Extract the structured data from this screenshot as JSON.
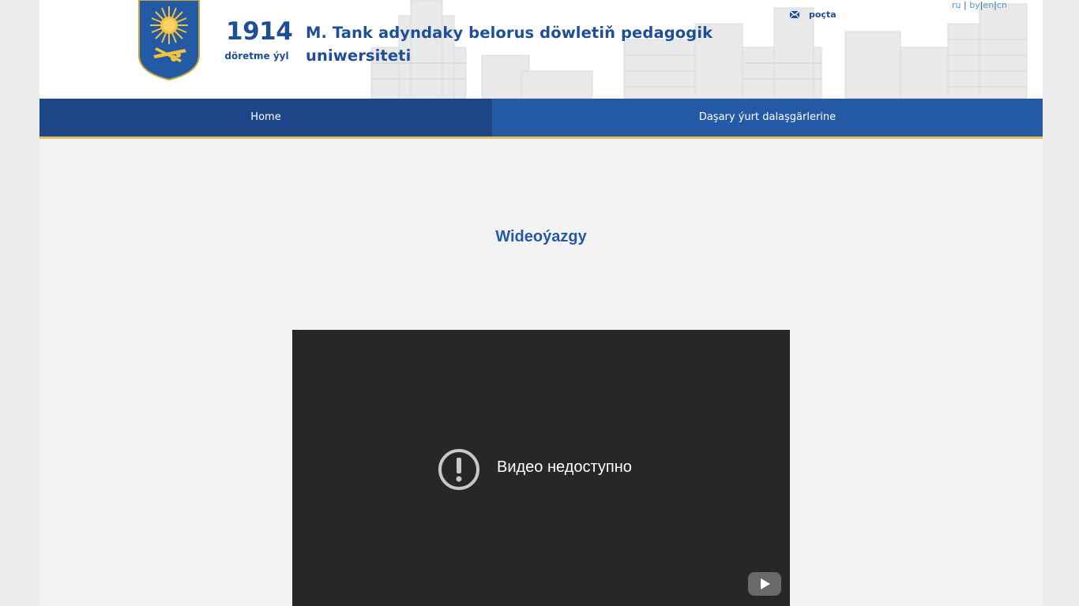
{
  "header": {
    "year": "1914",
    "year_caption": "döretme ýyl",
    "university_name": "M. Tank adyndaky belorus döwletiň pedagogik uniwersiteti",
    "mail_label": "poçta",
    "languages": {
      "ru": "ru",
      "separator": " | ",
      "by": "by",
      "en": "en",
      "cn": "cn"
    }
  },
  "nav": {
    "items": [
      {
        "label": "Home"
      },
      {
        "label": "Daşary ýurt dalaşgärlerine"
      }
    ]
  },
  "main": {
    "section_title": "Wideoýazgy",
    "video": {
      "message": "Видео недоступно"
    }
  },
  "colors": {
    "brand_blue": "#2459a6",
    "nav_active": "#1c4688",
    "nav_border": "#e2c158",
    "video_bg": "#272727"
  },
  "icons": {
    "mail": "mail-icon",
    "crest": "university-crest-logo",
    "alert": "alert-circle-icon",
    "youtube": "youtube-logo-icon"
  }
}
